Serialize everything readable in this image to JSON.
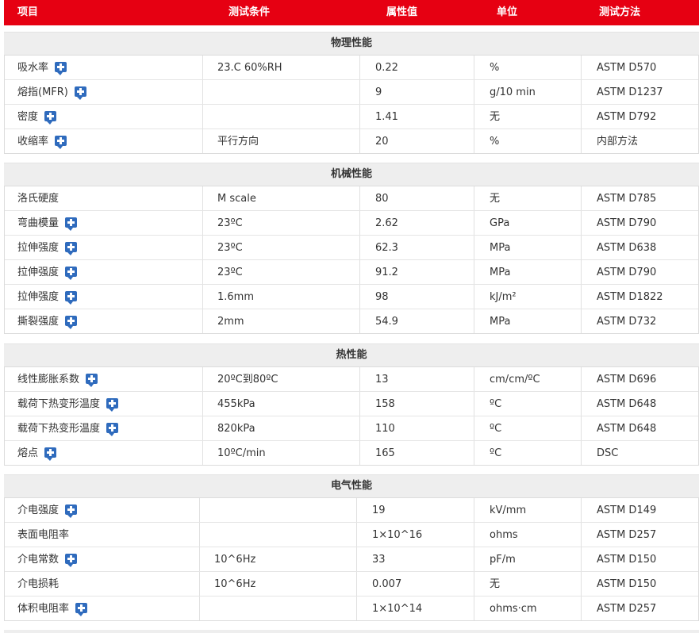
{
  "header": {
    "item": "项目",
    "condition": "测试条件",
    "value": "属性值",
    "unit": "单位",
    "method": "测试方法"
  },
  "colors": {
    "header_bg": "#e60012",
    "plus_icon": "#2f6bbd",
    "section_bg": "#eeeeee"
  },
  "sections": [
    {
      "title": "物理性能",
      "rows": [
        {
          "item": "吸水率",
          "plus": true,
          "condition": "23.C 60%RH",
          "value": "0.22",
          "unit": "%",
          "method": "ASTM D570"
        },
        {
          "item": "熔指(MFR)",
          "plus": true,
          "condition": "",
          "value": "9",
          "unit": "g/10 min",
          "method": "ASTM D1237"
        },
        {
          "item": "密度",
          "plus": true,
          "condition": "",
          "value": "1.41",
          "unit": "无",
          "method": "ASTM D792"
        },
        {
          "item": "收缩率",
          "plus": true,
          "condition": "平行方向",
          "value": "20",
          "unit": "%",
          "method": "内部方法"
        }
      ]
    },
    {
      "title": "机械性能",
      "rows": [
        {
          "item": "洛氏硬度",
          "plus": false,
          "condition": "M scale",
          "value": "80",
          "unit": "无",
          "method": "ASTM D785"
        },
        {
          "item": "弯曲模量",
          "plus": true,
          "condition": "23ºC",
          "value": "2.62",
          "unit": "GPa",
          "method": "ASTM D790"
        },
        {
          "item": "拉伸强度",
          "plus": true,
          "condition": "23ºC",
          "value": "62.3",
          "unit": "MPa",
          "method": "ASTM D638"
        },
        {
          "item": "拉伸强度",
          "plus": true,
          "condition": "23ºC",
          "value": "91.2",
          "unit": "MPa",
          "method": "ASTM D790"
        },
        {
          "item": "拉伸强度",
          "plus": true,
          "condition": "1.6mm",
          "value": "98",
          "unit": "kJ/m²",
          "method": "ASTM D1822"
        },
        {
          "item": "撕裂强度",
          "plus": true,
          "condition": "2mm",
          "value": "54.9",
          "unit": "MPa",
          "method": "ASTM D732"
        }
      ]
    },
    {
      "title": "热性能",
      "rows": [
        {
          "item": "线性膨胀系数",
          "plus": true,
          "condition": "20ºC到80ºC",
          "value": "13",
          "unit": "cm/cm/ºC",
          "method": "ASTM D696"
        },
        {
          "item": "载荷下热变形温度",
          "plus": true,
          "condition": "455kPa",
          "value": "158",
          "unit": "ºC",
          "method": "ASTM D648"
        },
        {
          "item": "载荷下热变形温度",
          "plus": true,
          "condition": "820kPa",
          "value": "110",
          "unit": "ºC",
          "method": "ASTM D648"
        },
        {
          "item": "熔点",
          "plus": true,
          "condition": "10ºC/min",
          "value": "165",
          "unit": "ºC",
          "method": "DSC"
        }
      ]
    },
    {
      "title": "电气性能",
      "rows": [
        {
          "item": "介电强度",
          "plus": true,
          "condition": "",
          "value": "19",
          "unit": "kV/mm",
          "method": "ASTM D149"
        },
        {
          "item": "表面电阻率",
          "plus": false,
          "condition": "",
          "value": "1×10^16",
          "unit": "ohms",
          "method": "ASTM D257"
        },
        {
          "item": "介电常数",
          "plus": true,
          "condition": "10^6Hz",
          "value": "33",
          "unit": "pF/m",
          "method": "ASTM D150"
        },
        {
          "item": "介电损耗",
          "plus": false,
          "condition": "10^6Hz",
          "value": "0.007",
          "unit": "无",
          "method": "ASTM D150"
        },
        {
          "item": "体积电阻率",
          "plus": true,
          "condition": "",
          "value": "1×10^14",
          "unit": "ohms·cm",
          "method": "ASTM D257"
        }
      ]
    }
  ]
}
